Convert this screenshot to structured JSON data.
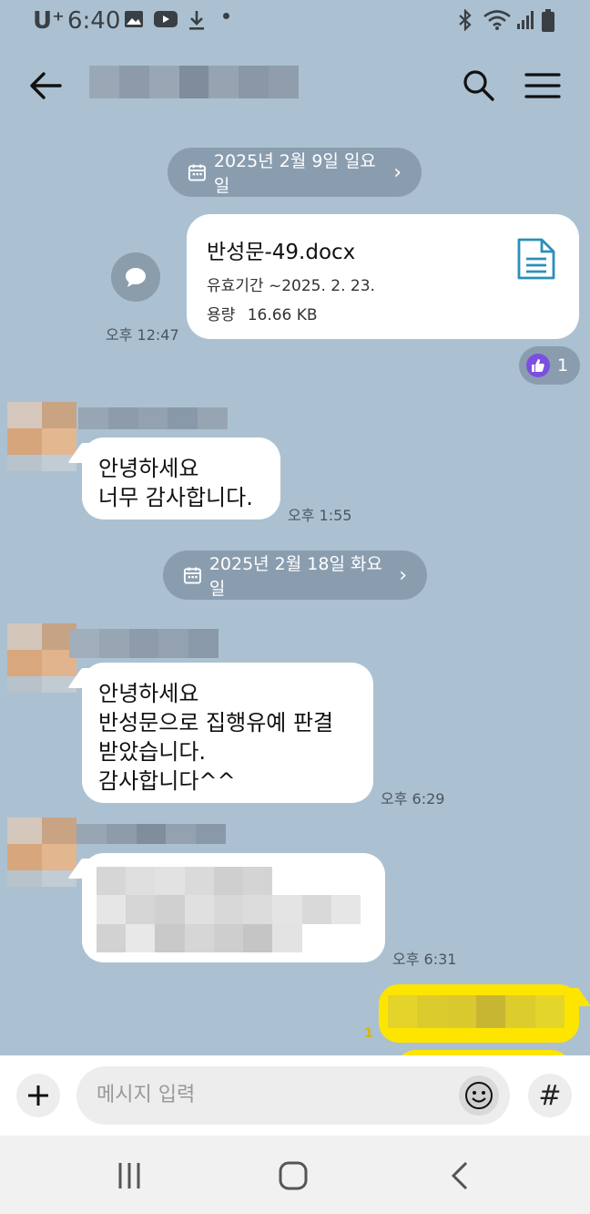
{
  "status_bar": {
    "carrier": "U⁺",
    "time": "6:40",
    "icons": [
      "image-icon",
      "youtube-icon",
      "download-icon",
      "bluetooth-icon",
      "wifi-icon",
      "signal-icon",
      "battery-icon"
    ]
  },
  "header": {
    "back_icon": "back-arrow-icon",
    "search_icon": "search-icon",
    "menu_icon": "menu-icon"
  },
  "chat": {
    "date_1": "2025년 2월 9일 일요일",
    "file": {
      "name": "반성문-49.docx",
      "expiry": "유효기간 ~2025. 2. 23.",
      "size_label": "용량",
      "size": "16.66 KB",
      "time": "오후 12:47"
    },
    "reaction_count": "1",
    "msg_1": {
      "line1": "안녕하세요",
      "line2": "너무 감사합니다.",
      "time": "오후 1:55"
    },
    "date_2": "2025년 2월 18일 화요일",
    "msg_2": {
      "line1": "안녕하세요",
      "line2": "반성문으로 집행유예 판결",
      "line3": "받았습니다.",
      "line4": "감사합니다^^",
      "time": "오후 6:29"
    },
    "msg_3": {
      "time": "오후 6:31"
    },
    "my_msg_unread": "1"
  },
  "input_bar": {
    "placeholder": "메시지 입력",
    "hash": "#"
  },
  "colors": {
    "background": "#abc1d1",
    "my_bubble": "#fee500",
    "reaction": "#7b4fe0"
  }
}
